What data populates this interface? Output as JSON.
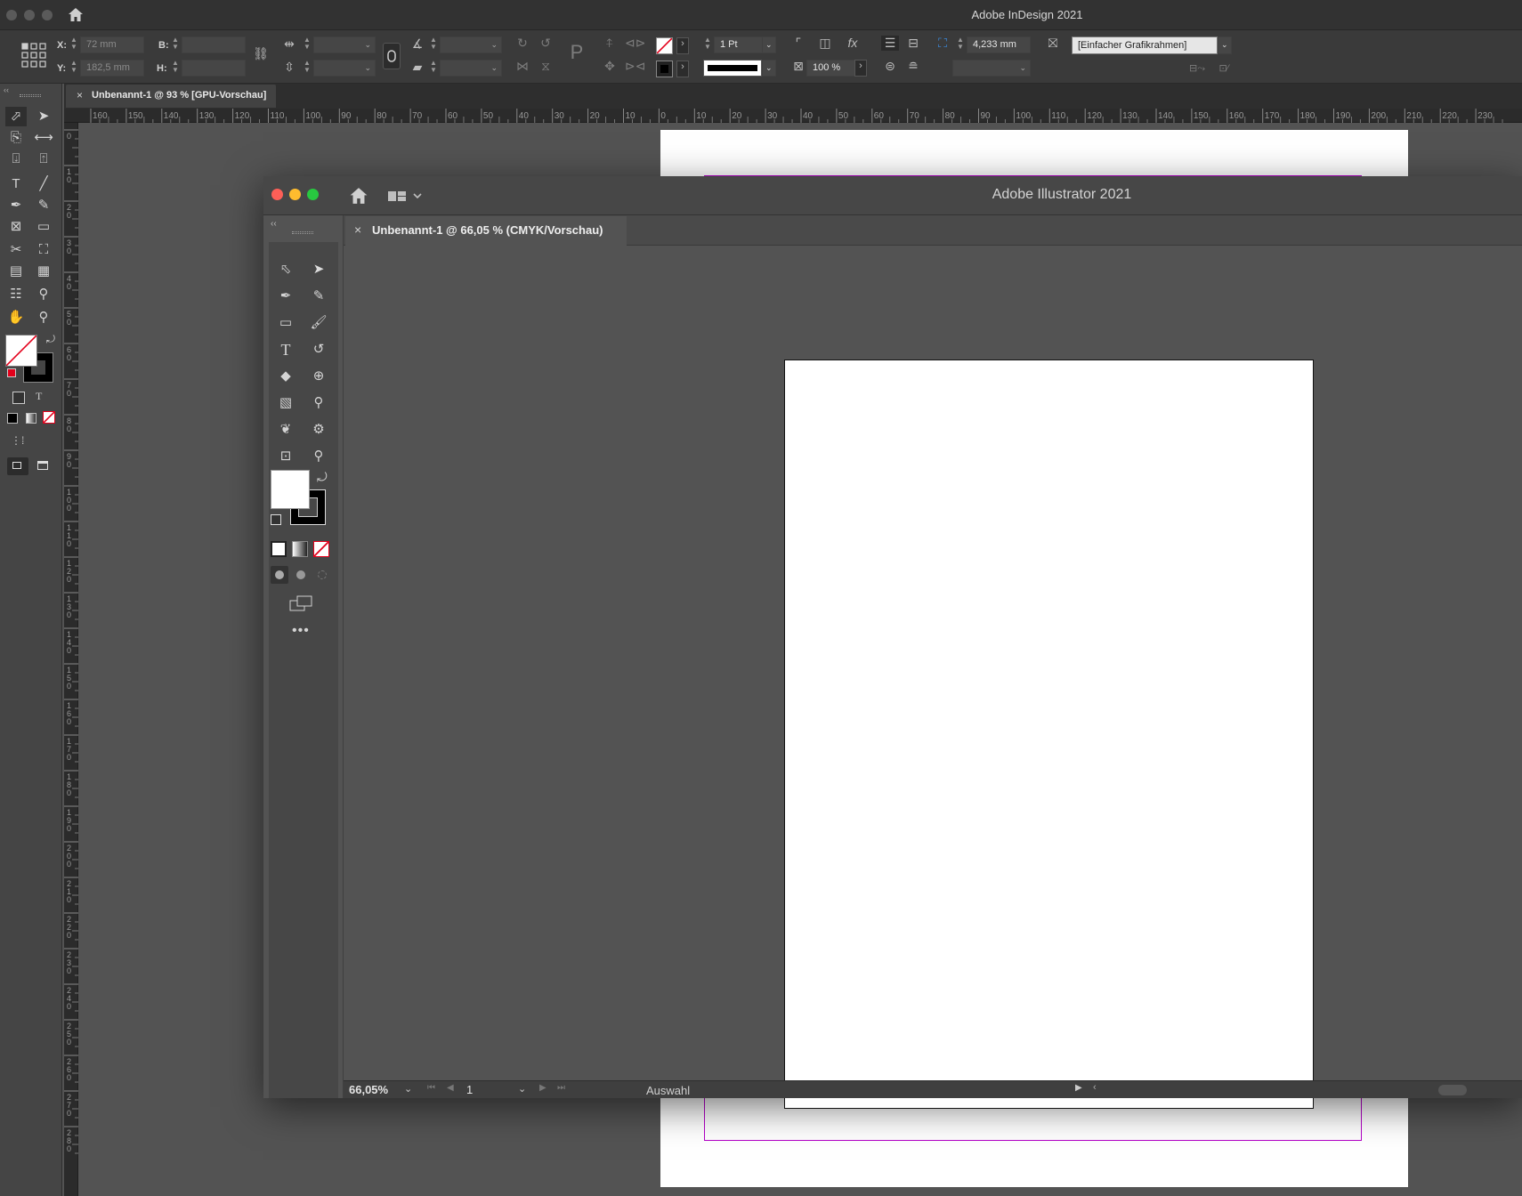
{
  "indesign": {
    "app_title": "Adobe InDesign 2021",
    "control": {
      "x_label": "X:",
      "x_value": "72 mm",
      "y_label": "Y:",
      "y_value": "182,5 mm",
      "b_label": "B:",
      "h_label": "H:",
      "stroke_weight": "1 Pt",
      "opacity": "100 %",
      "gap_value": "4,233 mm",
      "object_style": "[Einfacher Grafikrahmen]"
    },
    "tab": {
      "label": "Unbenannt-1 @ 93 % [GPU-Vorschau]",
      "close": "×"
    },
    "ruler_ticks": [
      "160",
      "150",
      "140",
      "130",
      "120",
      "110",
      "100",
      "90",
      "80",
      "70",
      "60",
      "50",
      "40",
      "30",
      "20",
      "10",
      "0",
      "10",
      "20",
      "30",
      "40",
      "50",
      "60",
      "70",
      "80",
      "90",
      "100",
      "110",
      "120",
      "130",
      "140",
      "150",
      "160",
      "170",
      "180",
      "190",
      "200",
      "210",
      "220",
      "230"
    ],
    "vruler_ticks": [
      "0",
      "10",
      "20",
      "30",
      "40",
      "50",
      "60",
      "70",
      "80",
      "90",
      "100",
      "110",
      "120",
      "130",
      "140",
      "150",
      "160",
      "170",
      "180",
      "190",
      "200",
      "210",
      "220",
      "230",
      "240",
      "250",
      "260",
      "270",
      "280"
    ],
    "colors": {
      "margin": "#b400c8",
      "chrome": "#323232"
    }
  },
  "illustrator": {
    "app_title": "Adobe Illustrator 2021",
    "tab": {
      "label": "Unbenannt-1 @ 66,05 % (CMYK/Vorschau)",
      "close": "×"
    },
    "status": {
      "zoom": "66,05%",
      "page": "1",
      "mode": "Auswahl"
    },
    "traffic_lights": {
      "close": "#fe5f57",
      "minimize": "#febc2e",
      "zoom": "#28c840"
    }
  }
}
